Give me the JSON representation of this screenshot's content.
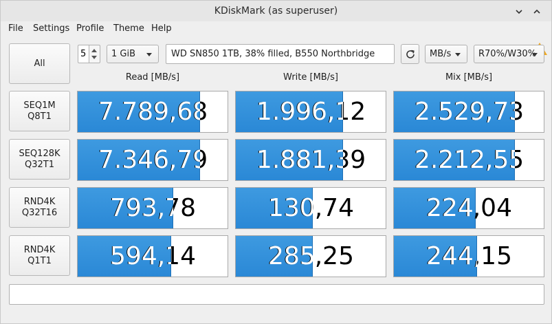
{
  "window": {
    "title": "KDiskMark (as superuser)"
  },
  "menu": [
    "File",
    "Settings",
    "Profile",
    "Theme",
    "Help"
  ],
  "controls": {
    "all_label": "All",
    "loops": "5",
    "size": "1 GiB",
    "device": "WD SN850 1TB, 38% filled, B550 Northbridge",
    "unit": "MB/s",
    "mix": "R70%/W30%"
  },
  "columns": {
    "read": "Read [MB/s]",
    "write": "Write [MB/s]",
    "mix": "Mix [MB/s]"
  },
  "rows": [
    {
      "line1": "SEQ1M",
      "line2": "Q8T1",
      "read": {
        "value": "7.789,68",
        "fill": 0.81
      },
      "write": {
        "value": "1.996,12",
        "fill": 0.71
      },
      "mix": {
        "value": "2.529,73",
        "fill": 0.8
      }
    },
    {
      "line1": "SEQ128K",
      "line2": "Q32T1",
      "read": {
        "value": "7.346,79",
        "fill": 0.81
      },
      "write": {
        "value": "1.881,39",
        "fill": 0.71
      },
      "mix": {
        "value": "2.212,55",
        "fill": 0.8
      }
    },
    {
      "line1": "RND4K",
      "line2": "Q32T16",
      "read": {
        "value": "793,78",
        "fill": 0.63
      },
      "write": {
        "value": "130,74",
        "fill": 0.51
      },
      "mix": {
        "value": "224,04",
        "fill": 0.54
      }
    },
    {
      "line1": "RND4K",
      "line2": "Q1T1",
      "read": {
        "value": "594,14",
        "fill": 0.62
      },
      "write": {
        "value": "285,25",
        "fill": 0.51
      },
      "mix": {
        "value": "244,15",
        "fill": 0.55
      }
    }
  ],
  "status": "",
  "colors": {
    "bar": "#2a88d6",
    "warning": "#f0a820"
  },
  "icons": {
    "minimize": "chevron-down-icon",
    "maximize": "chevron-up-icon",
    "close": "close-icon",
    "refresh": "refresh-icon",
    "warning": "warning-icon"
  }
}
